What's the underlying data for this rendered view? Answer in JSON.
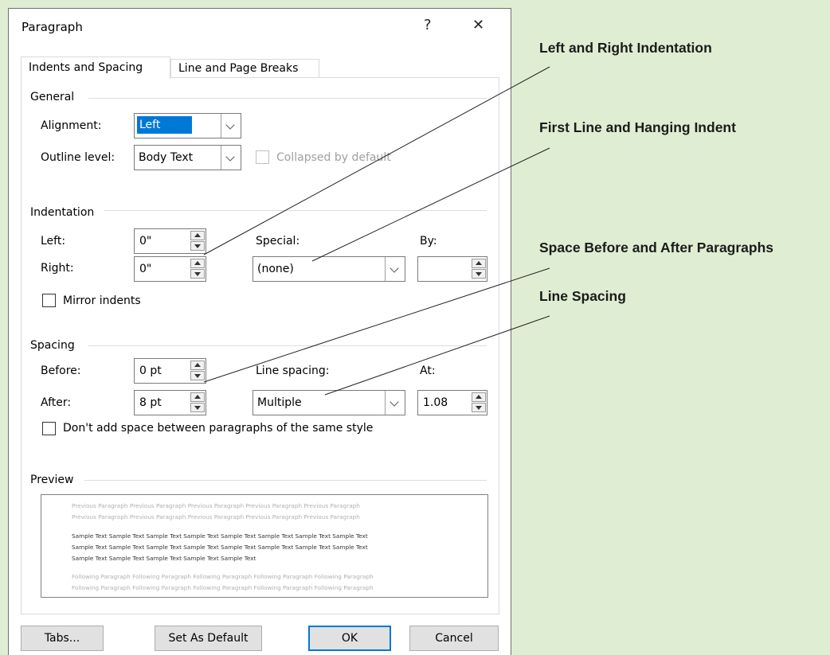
{
  "dialog": {
    "title": "Paragraph",
    "help_label": "?",
    "close_label": "✕",
    "tabs": [
      {
        "label": "Indents and Spacing",
        "active": true
      },
      {
        "label": "Line and Page Breaks",
        "active": false
      }
    ]
  },
  "general": {
    "heading": "General",
    "alignment_label": "Alignment:",
    "alignment_value": "Left",
    "outline_label": "Outline level:",
    "outline_value": "Body Text",
    "collapsed_label": "Collapsed by default"
  },
  "indentation": {
    "heading": "Indentation",
    "left_label": "Left:",
    "left_value": "0\"",
    "right_label": "Right:",
    "right_value": "0\"",
    "special_label": "Special:",
    "special_value": "(none)",
    "by_label": "By:",
    "by_value": "",
    "mirror_label": "Mirror indents"
  },
  "spacing": {
    "heading": "Spacing",
    "before_label": "Before:",
    "before_value": "0 pt",
    "after_label": "After:",
    "after_value": "8 pt",
    "line_spacing_label": "Line spacing:",
    "line_spacing_value": "Multiple",
    "at_label": "At:",
    "at_value": "1.08",
    "dont_add_label": "Don't add space between paragraphs of the same style"
  },
  "preview": {
    "heading": "Preview",
    "previous_lines": [
      "Previous Paragraph Previous Paragraph Previous Paragraph Previous Paragraph Previous Paragraph",
      "Previous Paragraph Previous Paragraph Previous Paragraph Previous Paragraph Previous Paragraph"
    ],
    "sample_lines": [
      "Sample Text Sample Text Sample Text Sample Text Sample Text Sample Text Sample Text Sample Text",
      "Sample Text Sample Text Sample Text Sample Text Sample Text Sample Text Sample Text Sample Text",
      "Sample Text Sample Text Sample Text Sample Text Sample Text"
    ],
    "following_lines": [
      "Following Paragraph Following Paragraph Following Paragraph Following Paragraph Following Paragraph",
      "Following Paragraph Following Paragraph Following Paragraph Following Paragraph Following Paragraph"
    ]
  },
  "buttons": {
    "tabs": "Tabs...",
    "set_default": "Set As Default",
    "ok": "OK",
    "cancel": "Cancel"
  },
  "callouts": {
    "left_right": "Left and Right Indentation",
    "first_hanging": "First Line and Hanging Indent",
    "space_before_after": "Space Before and After Paragraphs",
    "line_spacing": "Line Spacing"
  },
  "colors": {
    "background": "#dfeed2",
    "selection": "#0078d7"
  }
}
